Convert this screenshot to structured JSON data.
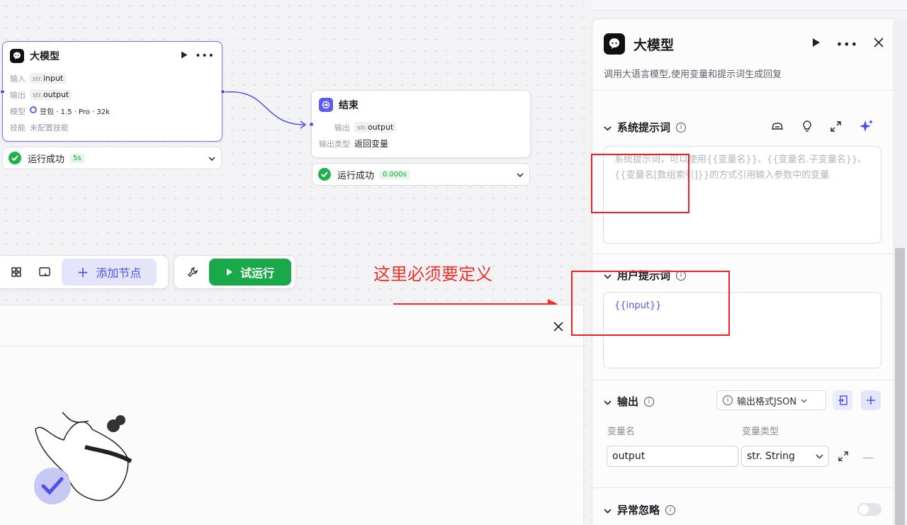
{
  "llm_node": {
    "title": "大模型",
    "rows": [
      {
        "label": "输入",
        "type": "str.",
        "value": "input"
      },
      {
        "label": "输出",
        "type": "str.",
        "value": "output"
      }
    ],
    "model_label": "模型",
    "model_value": "豆包 · 1.5 · Pro · 32k",
    "skill_label": "技能",
    "skill_value": "未配置技能",
    "status": "运行成功",
    "time": "5s"
  },
  "end_node": {
    "title": "结束",
    "output_label": "输出",
    "output_type": "str.",
    "output_value": "output",
    "output_kind_label": "输出类型",
    "output_kind_value": "返回变量",
    "status": "运行成功",
    "time": "0.000s"
  },
  "toolbar": {
    "add_node_label": "添加节点",
    "run_label": "试运行"
  },
  "annotation": {
    "text": "这里必须要定义"
  },
  "side_panel": {
    "title": "大模型",
    "description": "调用大语言模型,使用变量和提示词生成回复",
    "system_prompt": {
      "title": "系统提示词",
      "placeholder": "系统提示词，可以使用{{变量名}}、{{变量名.子变量名}}、{{变量名[数组索引]}}的方式引用输入参数中的变量"
    },
    "user_prompt": {
      "title": "用户提示词",
      "value": "{{input}}"
    },
    "output": {
      "title": "输出",
      "format_label": "输出格式JSON",
      "col_name": "变量名",
      "col_type": "变量类型",
      "var_name": "output",
      "var_type": "str. String"
    },
    "exception": {
      "title": "异常忽略"
    }
  },
  "colors": {
    "accent": "#4d53e8",
    "success": "#22b14c",
    "run_button": "#1aa94a",
    "annotation": "#f0302a"
  }
}
